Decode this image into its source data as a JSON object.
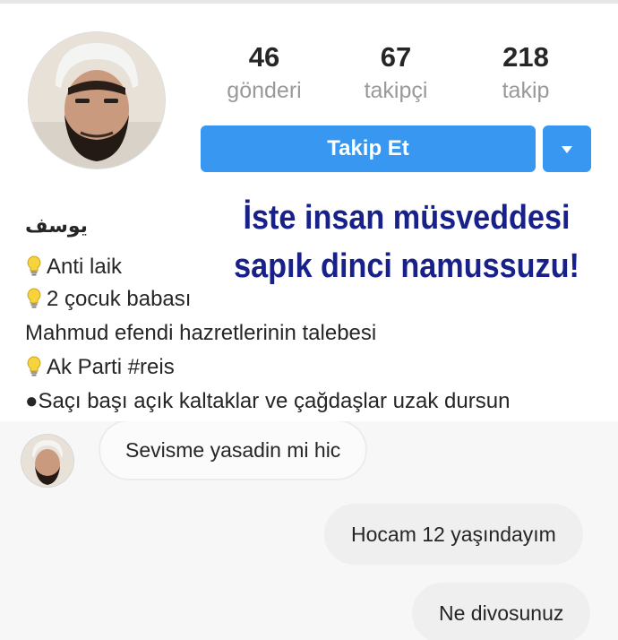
{
  "profile": {
    "stats": [
      {
        "value": "46",
        "label": "gönderi"
      },
      {
        "value": "67",
        "label": "takipçi"
      },
      {
        "value": "218",
        "label": "takip"
      }
    ],
    "follow_button": "Takip Et",
    "dropdown_icon": "caret-down-icon",
    "name": "يوسف",
    "bio_lines": [
      "Anti laik",
      "2 çocuk babası",
      "Mahmud efendi hazretlerinin talebesi",
      "Ak Parti #reis",
      "●Saçı başı açık kaltaklar ve çağdaşlar uzak dursun"
    ],
    "accent_color": "#3897f0"
  },
  "caption": {
    "line1": "İste insan müsveddesi",
    "line2": "sapık dinci namussuzu!",
    "color": "#18208a"
  },
  "chat": {
    "messages": [
      {
        "from": "them",
        "text": "Sevisme yasadin mi hic"
      },
      {
        "from": "me",
        "text": "Hocam 12 yaşındayım"
      },
      {
        "from": "me",
        "text": "Ne divosunuz"
      }
    ]
  }
}
